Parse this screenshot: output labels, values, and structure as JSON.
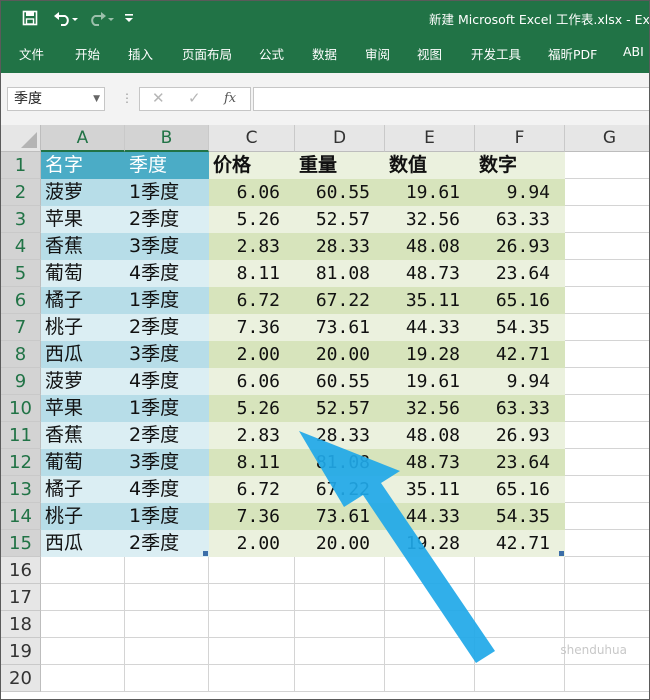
{
  "window": {
    "title": "新建 Microsoft Excel 工作表.xlsx  -  Ex",
    "qat": [
      "save-icon",
      "undo-icon",
      "redo-icon",
      "customize-icon"
    ]
  },
  "ribbon": {
    "tabs": [
      "文件",
      "开始",
      "插入",
      "页面布局",
      "公式",
      "数据",
      "审阅",
      "视图",
      "开发工具",
      "福昕PDF",
      "ABI"
    ]
  },
  "formula_bar": {
    "name_box": "季度",
    "cancel_glyph": "✕",
    "enter_glyph": "✓",
    "fx_label": "fx",
    "formula": ""
  },
  "columns": [
    "A",
    "B",
    "C",
    "D",
    "E",
    "F",
    "G"
  ],
  "rows": [
    "1",
    "2",
    "3",
    "4",
    "5",
    "6",
    "7",
    "8",
    "9",
    "10",
    "11",
    "12",
    "13",
    "14",
    "15",
    "16",
    "17",
    "18",
    "19",
    "20"
  ],
  "table": {
    "headers": [
      "名字",
      "季度",
      "价格",
      "重量",
      "数值",
      "数字"
    ],
    "data": [
      [
        "菠萝",
        "1季度",
        "6.06",
        "60.55",
        "19.61",
        "9.94"
      ],
      [
        "苹果",
        "2季度",
        "5.26",
        "52.57",
        "32.56",
        "63.33"
      ],
      [
        "香蕉",
        "3季度",
        "2.83",
        "28.33",
        "48.08",
        "26.93"
      ],
      [
        "葡萄",
        "4季度",
        "8.11",
        "81.08",
        "48.73",
        "23.64"
      ],
      [
        "橘子",
        "1季度",
        "6.72",
        "67.22",
        "35.11",
        "65.16"
      ],
      [
        "桃子",
        "2季度",
        "7.36",
        "73.61",
        "44.33",
        "54.35"
      ],
      [
        "西瓜",
        "3季度",
        "2.00",
        "20.00",
        "19.28",
        "42.71"
      ],
      [
        "菠萝",
        "4季度",
        "6.06",
        "60.55",
        "19.61",
        "9.94"
      ],
      [
        "苹果",
        "1季度",
        "5.26",
        "52.57",
        "32.56",
        "63.33"
      ],
      [
        "香蕉",
        "2季度",
        "2.83",
        "28.33",
        "48.08",
        "26.93"
      ],
      [
        "葡萄",
        "3季度",
        "8.11",
        "81.08",
        "48.73",
        "23.64"
      ],
      [
        "橘子",
        "4季度",
        "6.72",
        "67.22",
        "35.11",
        "65.16"
      ],
      [
        "桃子",
        "1季度",
        "7.36",
        "73.61",
        "44.33",
        "54.35"
      ],
      [
        "西瓜",
        "2季度",
        "2.00",
        "20.00",
        "19.28",
        "42.71"
      ]
    ]
  },
  "colors": {
    "ribbon": "#217346",
    "blue_header": "#4bacc6",
    "blue_band_1": "#b7dde8",
    "blue_band_2": "#dbeef3",
    "green_header": "#ebf1de",
    "green_band_1": "#d7e4bc",
    "green_band_2": "#ebf1de",
    "arrow": "#1fa8e8"
  },
  "watermark": "shenduhua"
}
